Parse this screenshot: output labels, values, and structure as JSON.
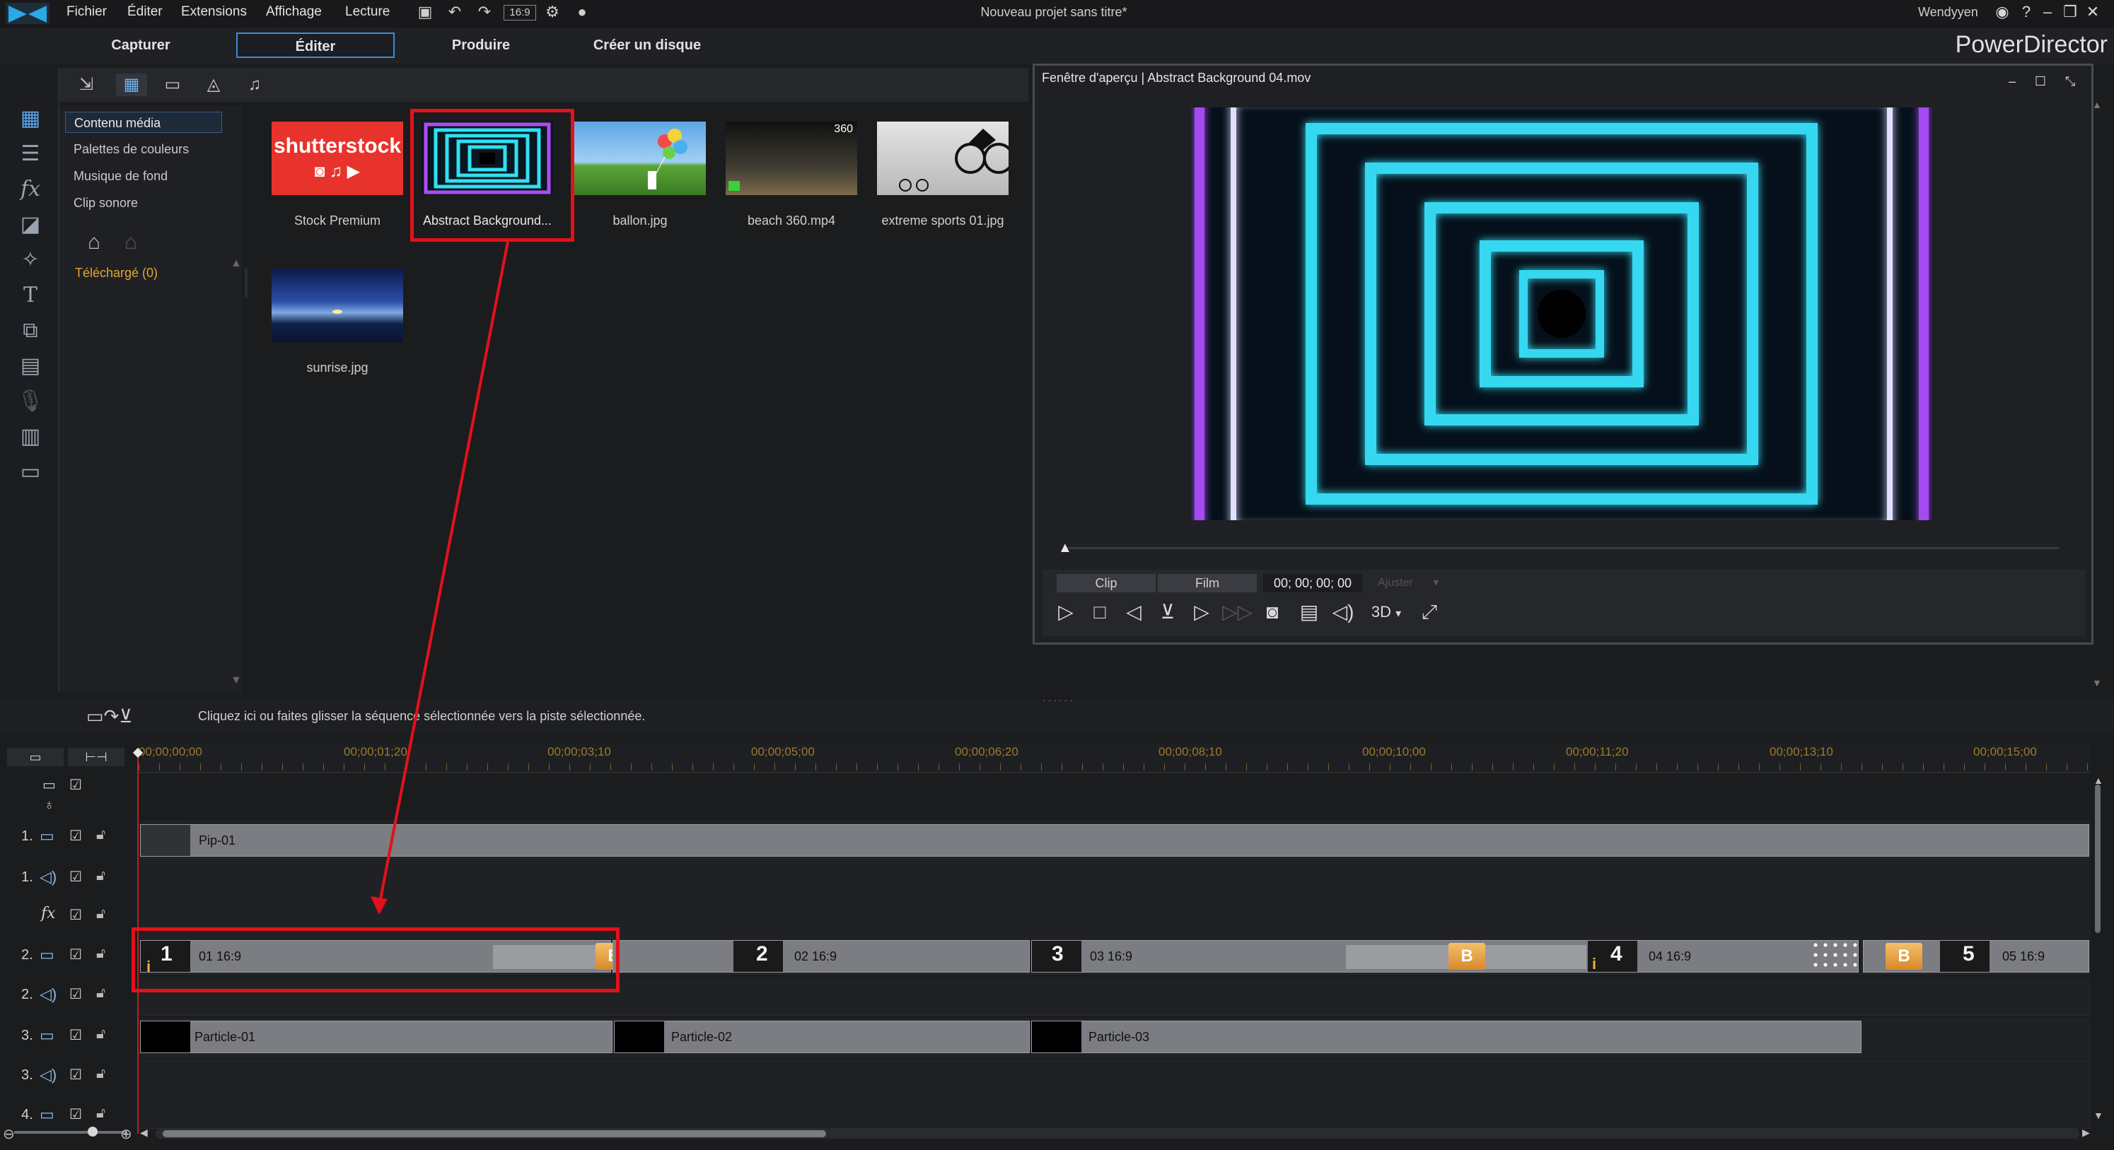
{
  "menu": {
    "file": "Fichier",
    "edit": "Éditer",
    "extensions": "Extensions",
    "view": "Affichage",
    "play": "Lecture",
    "aspect": "16:9"
  },
  "window": {
    "title": "Nouveau projet sans titre*",
    "user": "Wendyyen",
    "help": "?",
    "brand": "PowerDirector"
  },
  "modes": {
    "capture": "Capturer",
    "edit": "Éditer",
    "produce": "Produire",
    "disc": "Créer un disque"
  },
  "library": {
    "items": [
      "Contenu média",
      "Palettes de couleurs",
      "Musique de fond",
      "Clip sonore"
    ],
    "downloaded": "Téléchargé  (0)",
    "media": [
      {
        "label": "Stock Premium",
        "logo": "shutterstock"
      },
      {
        "label": "Abstract Background..."
      },
      {
        "label": "ballon.jpg"
      },
      {
        "label": "beach 360.mp4",
        "badge": "360"
      },
      {
        "label": "extreme sports 01.jpg"
      },
      {
        "label": "sunrise.jpg"
      }
    ]
  },
  "preview": {
    "title": "Fenêtre d'aperçu | Abstract Background 04.mov",
    "clip_btn": "Clip",
    "film_btn": "Film",
    "timecode": "00; 00; 00; 00",
    "adjust": "Ajuster",
    "mode3d": "3D"
  },
  "hint": "Cliquez ici ou faites glisser la séquence sélectionnée vers la piste sélectionnée.",
  "timeline": {
    "ticks": [
      "00;00;00;00",
      "00;00;01;20",
      "00;00;03;10",
      "00;00;05;00",
      "00;00;06;20",
      "00;00;08;10",
      "00;00;10;00",
      "00;00;11;20",
      "00;00;13;10",
      "00;00;15;00"
    ],
    "tracks": [
      {
        "num": "1.",
        "type": "video"
      },
      {
        "num": "1.",
        "type": "audio"
      },
      {
        "num": "fx",
        "type": "fx"
      },
      {
        "num": "2.",
        "type": "video"
      },
      {
        "num": "2.",
        "type": "audio"
      },
      {
        "num": "3.",
        "type": "video"
      },
      {
        "num": "3.",
        "type": "audio"
      },
      {
        "num": "4.",
        "type": "video"
      }
    ],
    "pip_clip": "Pip-01",
    "video2_clips": [
      {
        "num": "1",
        "label": "01 16:9"
      },
      {
        "num": "2",
        "label": "02 16:9"
      },
      {
        "num": "3",
        "label": "03 16:9"
      },
      {
        "num": "4",
        "label": "04 16:9"
      },
      {
        "num": "5",
        "label": "05 16:9"
      }
    ],
    "transition_glyph": "B",
    "info_glyph": "i",
    "particle_clips": [
      "Particle-01",
      "Particle-02",
      "Particle-03"
    ]
  },
  "colors": {
    "accent": "#3f8ad8",
    "highlight": "#e3111a",
    "download": "#e2a530"
  }
}
